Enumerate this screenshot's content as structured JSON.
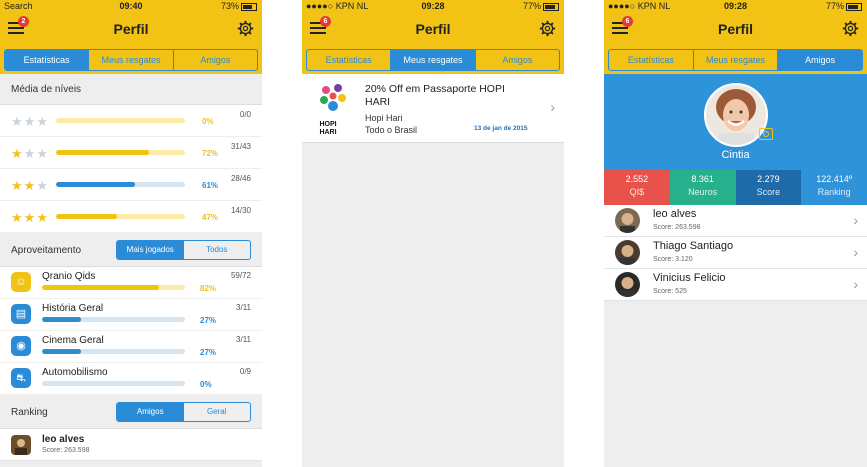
{
  "screen1": {
    "status": {
      "left": "Search",
      "time": "09:40",
      "right": "73%"
    },
    "title": "Perfil",
    "badge": "2",
    "tabs": [
      {
        "label": "Estatísticas",
        "active": true
      },
      {
        "label": "Meus resgates",
        "active": false
      },
      {
        "label": "Amigos",
        "active": false
      }
    ],
    "levels_header": "Média de níveis",
    "levels": [
      {
        "stars": 0,
        "pct_label": "0%",
        "fraction": 0.0,
        "ratio": "0/0",
        "color": "#f2c314"
      },
      {
        "stars": 1,
        "pct_label": "72%",
        "fraction": 0.72,
        "ratio": "31/43",
        "color": "#f2c314"
      },
      {
        "stars": 2,
        "pct_label": "61%",
        "fraction": 0.61,
        "ratio": "28/46",
        "color": "#2a8bd6"
      },
      {
        "stars": 3,
        "pct_label": "47%",
        "fraction": 0.47,
        "ratio": "14/30",
        "color": "#f2c314"
      }
    ],
    "aprov_header": "Aproveitamento",
    "aprov_toggle": [
      "Mais jogados",
      "Todos"
    ],
    "categories": [
      {
        "name": "Qranio Qids",
        "pct_label": "82%",
        "fraction": 0.82,
        "ratio": "59/72",
        "color": "#f2c314",
        "icon_color": "#f2c314",
        "icon": "qids-icon"
      },
      {
        "name": "História Geral",
        "pct_label": "27%",
        "fraction": 0.27,
        "ratio": "3/11",
        "color": "#2a8bd6",
        "icon_color": "#2a8bd6",
        "icon": "history-icon"
      },
      {
        "name": "Cinema Geral",
        "pct_label": "27%",
        "fraction": 0.27,
        "ratio": "3/11",
        "color": "#2a8bd6",
        "icon_color": "#2a8bd6",
        "icon": "cinema-icon"
      },
      {
        "name": "Automobilismo",
        "pct_label": "0%",
        "fraction": 0.0,
        "ratio": "0/9",
        "color": "#2a8bd6",
        "icon_color": "#2a8bd6",
        "icon": "car-icon"
      }
    ],
    "ranking_header": "Ranking",
    "ranking_toggle": [
      "Amigos",
      "Geral"
    ],
    "ranking": [
      {
        "name": "leo alves",
        "score": "Score: 263.598"
      }
    ]
  },
  "screen2": {
    "status": {
      "carrier": "KPN NL",
      "time": "09:28",
      "right": "77%"
    },
    "title": "Perfil",
    "badge": "6",
    "tabs": [
      {
        "label": "Estatísticas",
        "active": false
      },
      {
        "label": "Meus resgates",
        "active": true
      },
      {
        "label": "Amigos",
        "active": false
      }
    ],
    "reward": {
      "title": "20% Off em Passaporte HOPI HARI",
      "company": "Hopi Hari",
      "region": "Todo o Brasil",
      "date": "13 de jan de 2015",
      "logo_text": "HOPI HARI"
    }
  },
  "screen3": {
    "status": {
      "carrier": "KPN NL",
      "time": "09:28",
      "right": "77%"
    },
    "title": "Perfil",
    "badge": "6",
    "tabs": [
      {
        "label": "Estatísticas",
        "active": false
      },
      {
        "label": "Meus resgates",
        "active": false
      },
      {
        "label": "Amigos",
        "active": true
      }
    ],
    "profile_name": "Cintia",
    "stats": [
      {
        "value": "2.552",
        "label": "QI$",
        "color": "#e8524a"
      },
      {
        "value": "8.361",
        "label": "Neuros",
        "color": "#26b08c"
      },
      {
        "value": "2.279",
        "label": "Score",
        "color": "#1f6aa8"
      },
      {
        "value": "122.414º",
        "label": "Ranking",
        "color": "#2e93d9"
      }
    ],
    "friends": [
      {
        "name": "leo alves",
        "score": "Score: 263.598"
      },
      {
        "name": "Thiago Santiago",
        "score": "Score: 3.120"
      },
      {
        "name": "Vinicius Felicio",
        "score": "Score: 525"
      }
    ]
  }
}
